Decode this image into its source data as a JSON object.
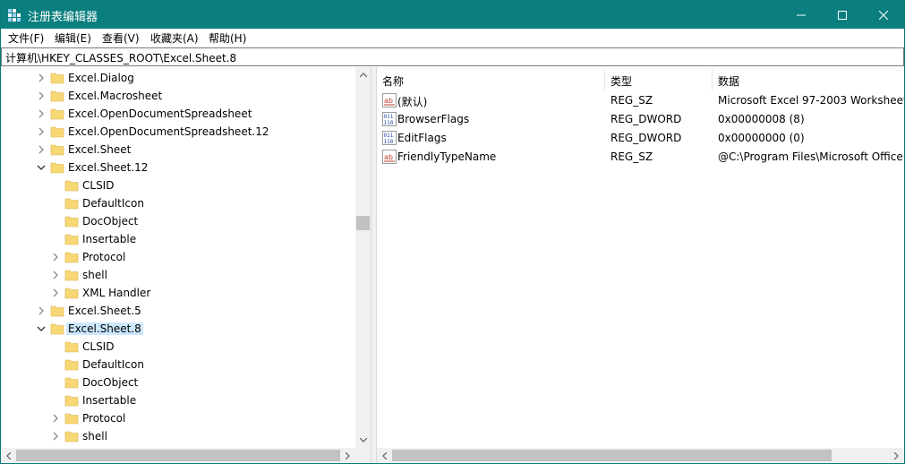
{
  "window": {
    "title": "注册表编辑器",
    "accent": "#0b7f7f"
  },
  "menu": [
    {
      "label": "文件(F)"
    },
    {
      "label": "编辑(E)"
    },
    {
      "label": "查看(V)"
    },
    {
      "label": "收藏夹(A)"
    },
    {
      "label": "帮助(H)"
    }
  ],
  "address": {
    "path": "计算机\\HKEY_CLASSES_ROOT\\Excel.Sheet.8"
  },
  "tree": {
    "items": [
      {
        "label": "Excel.Dialog",
        "expander": "collapsed",
        "depth": 0
      },
      {
        "label": "Excel.Macrosheet",
        "expander": "collapsed",
        "depth": 0
      },
      {
        "label": "Excel.OpenDocumentSpreadsheet",
        "expander": "collapsed",
        "depth": 0
      },
      {
        "label": "Excel.OpenDocumentSpreadsheet.12",
        "expander": "collapsed",
        "depth": 0
      },
      {
        "label": "Excel.Sheet",
        "expander": "collapsed",
        "depth": 0
      },
      {
        "label": "Excel.Sheet.12",
        "expander": "expanded",
        "depth": 0
      },
      {
        "label": "CLSID",
        "expander": "none",
        "depth": 1
      },
      {
        "label": "DefaultIcon",
        "expander": "none",
        "depth": 1
      },
      {
        "label": "DocObject",
        "expander": "none",
        "depth": 1
      },
      {
        "label": "Insertable",
        "expander": "none",
        "depth": 1
      },
      {
        "label": "Protocol",
        "expander": "collapsed",
        "depth": 1
      },
      {
        "label": "shell",
        "expander": "collapsed",
        "depth": 1
      },
      {
        "label": "XML Handler",
        "expander": "collapsed",
        "depth": 1
      },
      {
        "label": "Excel.Sheet.5",
        "expander": "collapsed",
        "depth": 0
      },
      {
        "label": "Excel.Sheet.8",
        "expander": "expanded",
        "depth": 0,
        "selected": true
      },
      {
        "label": "CLSID",
        "expander": "none",
        "depth": 1
      },
      {
        "label": "DefaultIcon",
        "expander": "none",
        "depth": 1
      },
      {
        "label": "DocObject",
        "expander": "none",
        "depth": 1
      },
      {
        "label": "Insertable",
        "expander": "none",
        "depth": 1
      },
      {
        "label": "Protocol",
        "expander": "collapsed",
        "depth": 1
      },
      {
        "label": "shell",
        "expander": "collapsed",
        "depth": 1
      }
    ]
  },
  "values": {
    "columns": {
      "name": "名称",
      "type": "类型",
      "data": "数据"
    },
    "rows": [
      {
        "icon": "string-value-icon",
        "name": "(默认)",
        "type": "REG_SZ",
        "data": "Microsoft Excel 97-2003 Worksheet"
      },
      {
        "icon": "binary-value-icon",
        "name": "BrowserFlags",
        "type": "REG_DWORD",
        "data": "0x00000008 (8)"
      },
      {
        "icon": "binary-value-icon",
        "name": "EditFlags",
        "type": "REG_DWORD",
        "data": "0x00000000 (0)"
      },
      {
        "icon": "string-value-icon",
        "name": "FriendlyTypeName",
        "type": "REG_SZ",
        "data": "@C:\\Program Files\\Microsoft Office"
      }
    ]
  },
  "colors": {
    "folder": "#f8d775",
    "selection": "#cce8ff"
  }
}
